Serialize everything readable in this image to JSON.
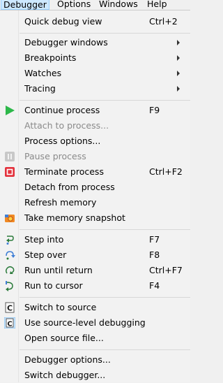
{
  "menubar": {
    "items": [
      "Debugger",
      "Options",
      "Windows",
      "Help"
    ]
  },
  "menu": {
    "quick_debug_view": {
      "label": "Quick debug view",
      "shortcut": "Ctrl+2"
    },
    "debugger_windows": {
      "label": "Debugger windows"
    },
    "breakpoints": {
      "label": "Breakpoints"
    },
    "watches": {
      "label": "Watches"
    },
    "tracing": {
      "label": "Tracing"
    },
    "continue_process": {
      "label": "Continue process",
      "shortcut": "F9",
      "icon": "play-icon"
    },
    "attach_to_process": {
      "label": "Attach to process..."
    },
    "process_options": {
      "label": "Process options..."
    },
    "pause_process": {
      "label": "Pause process",
      "icon": "pause-icon"
    },
    "terminate_process": {
      "label": "Terminate process",
      "shortcut": "Ctrl+F2",
      "icon": "stop-icon"
    },
    "detach_from_process": {
      "label": "Detach from process"
    },
    "refresh_memory": {
      "label": "Refresh memory"
    },
    "take_memory_snapshot": {
      "label": "Take memory snapshot",
      "icon": "camera-icon"
    },
    "step_into": {
      "label": "Step into",
      "shortcut": "F7",
      "icon": "step-into-icon"
    },
    "step_over": {
      "label": "Step over",
      "shortcut": "F8",
      "icon": "step-over-icon"
    },
    "run_until_return": {
      "label": "Run until return",
      "shortcut": "Ctrl+F7",
      "icon": "run-until-return-icon"
    },
    "run_to_cursor": {
      "label": "Run to cursor",
      "shortcut": "F4",
      "icon": "run-to-cursor-icon"
    },
    "switch_to_source": {
      "label": "Switch to source",
      "icon": "source-icon"
    },
    "use_source_level_debugging": {
      "label": "Use source-level debugging",
      "icon": "source-level-icon"
    },
    "open_source_file": {
      "label": "Open source file..."
    },
    "debugger_options": {
      "label": "Debugger options..."
    },
    "switch_debugger": {
      "label": "Switch debugger..."
    }
  },
  "colors": {
    "play": "#2db84a",
    "stop": "#e3323d",
    "disabled": "#8a8a8a",
    "menubar_active": "#cde8ff"
  }
}
